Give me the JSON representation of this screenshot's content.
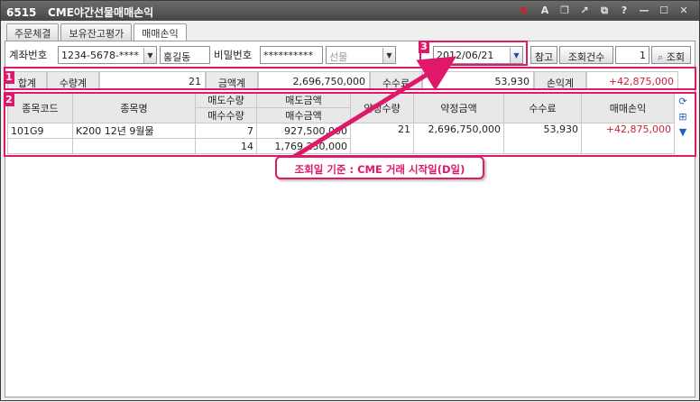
{
  "window": {
    "screen_no": "6515",
    "title": "CME야간선물매매손익",
    "icons": [
      "play-icon",
      "font-icon",
      "copy-icon",
      "link-icon",
      "restore-icon",
      "help-icon",
      "minimize-icon",
      "maximize-icon",
      "close-icon"
    ]
  },
  "tabs": [
    {
      "label": "주문체결"
    },
    {
      "label": "보유잔고평가"
    },
    {
      "label": "매매손익"
    }
  ],
  "form": {
    "account_label": "계좌번호",
    "account_value": "1234-5678-****",
    "holder_name": "홍길동",
    "password_label": "비밀번호",
    "password_value": "**********",
    "product_value": "선물",
    "date_value": "2012/06/21",
    "ref_button": "참고",
    "count_label": "조회건수",
    "count_value": "1",
    "search_button": "조회"
  },
  "badges": {
    "b1": "1",
    "b2": "2",
    "b3": "3"
  },
  "summary": {
    "total_label": "합계",
    "qty_label": "수량계",
    "qty_value": "21",
    "amount_label": "금액계",
    "amount_value": "2,696,750,000",
    "fee_label": "수수료",
    "fee_value": "53,930",
    "pnl_label": "손익계",
    "pnl_value": "+42,875,000"
  },
  "grid": {
    "headers": {
      "code": "종목코드",
      "name": "종목명",
      "sell_qty": "매도수량",
      "buy_qty": "매수수량",
      "sell_amt": "매도금액",
      "buy_amt": "매수금액",
      "exec_qty": "약정수량",
      "exec_amt": "약정금액",
      "fee": "수수료",
      "pnl": "매매손익"
    },
    "rows": [
      {
        "code": "101G9",
        "name": "K200 12년  9월물",
        "sell_qty": "7",
        "buy_qty": "14",
        "sell_amt": "927,500,000",
        "buy_amt": "1,769,250,000",
        "exec_qty": "21",
        "exec_amt": "2,696,750,000",
        "fee": "53,930",
        "pnl": "+42,875,000"
      }
    ]
  },
  "callout": {
    "text": "조회일 기준 : CME 거래 시작일(D일)"
  },
  "colors": {
    "accent": "#e0186a",
    "positive": "#d0203a",
    "titlebar": "#4a4a4a"
  }
}
